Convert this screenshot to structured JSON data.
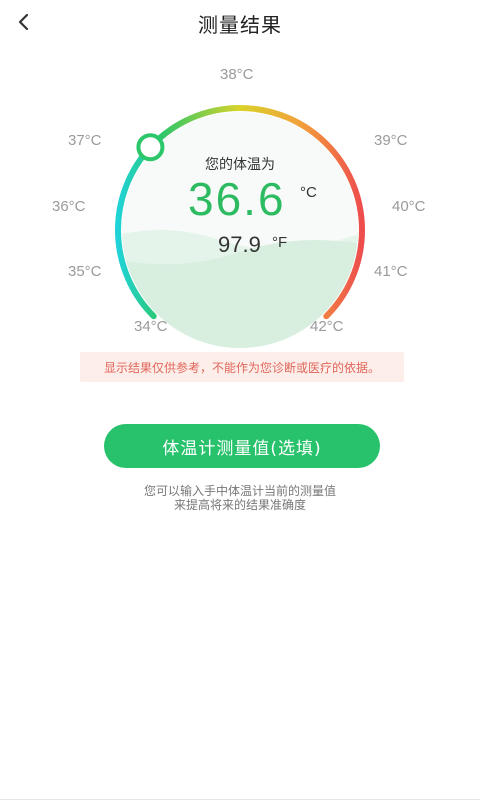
{
  "header": {
    "title": "测量结果",
    "back_icon": "chevron-left-icon"
  },
  "gauge": {
    "ticks": [
      "34°C",
      "35°C",
      "36°C",
      "37°C",
      "38°C",
      "39°C",
      "40°C",
      "41°C",
      "42°C"
    ],
    "min_c": 34,
    "max_c": 42,
    "value_c": 36.6,
    "gradient_colors": [
      "#20d3d8",
      "#2cc76a",
      "#d9d32a",
      "#f2a03b",
      "#ee4d4d"
    ]
  },
  "reading": {
    "label": "您的体温为",
    "celsius": "36.6",
    "celsius_unit": "°C",
    "fahrenheit": "97.9",
    "fahrenheit_unit": "°F"
  },
  "disclaimer": "显示结果仅供参考，不能作为您诊断或医疗的依据。",
  "action": {
    "button_label": "体温计测量值(选填)",
    "hint_line1": "您可以输入手中体温计当前的测量值",
    "hint_line2": "来提高将来的结果准确度"
  },
  "colors": {
    "accent": "#27c26b",
    "value_green": "#2dbb62",
    "warning_text": "#e0665a",
    "warning_bg": "#fdeeea"
  }
}
